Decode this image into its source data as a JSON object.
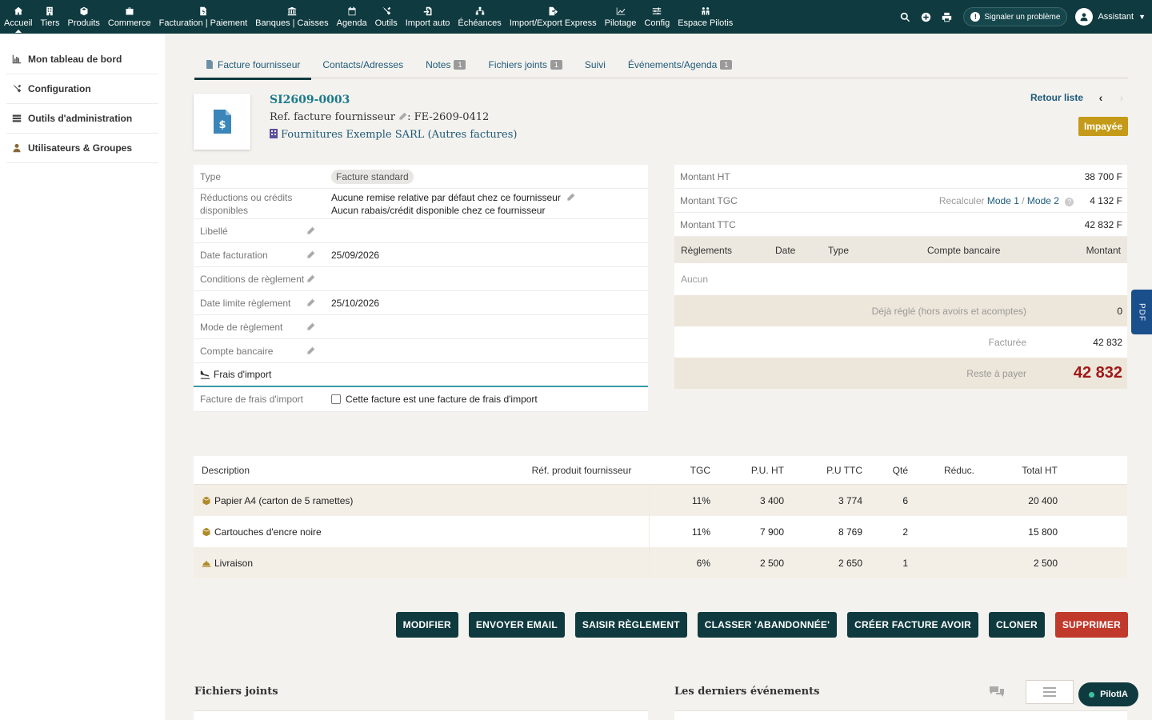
{
  "topbar": {
    "menu": [
      {
        "label": "Accueil",
        "icon": "home-icon"
      },
      {
        "label": "Tiers",
        "icon": "building-icon"
      },
      {
        "label": "Produits",
        "icon": "cube-icon"
      },
      {
        "label": "Commerce",
        "icon": "briefcase-icon"
      },
      {
        "label": "Facturation | Paiement",
        "icon": "file-dollar-icon"
      },
      {
        "label": "Banques | Caisses",
        "icon": "bank-icon"
      },
      {
        "label": "Agenda",
        "icon": "calendar-icon"
      },
      {
        "label": "Outils",
        "icon": "tools-icon"
      },
      {
        "label": "Import auto",
        "icon": "file-import-icon"
      },
      {
        "label": "Échéances",
        "icon": "sitemap-icon"
      },
      {
        "label": "Import/Export Express",
        "icon": "file-export-icon"
      },
      {
        "label": "Pilotage",
        "icon": "chart-icon"
      },
      {
        "label": "Config",
        "icon": "sliders-icon"
      },
      {
        "label": "Espace Pilotis",
        "icon": "people-icon"
      }
    ],
    "report_label": "Signaler un problème",
    "user_label": "Assistant"
  },
  "sidebar": {
    "items": [
      {
        "label": "Mon tableau de bord"
      },
      {
        "label": "Configuration"
      },
      {
        "label": "Outils d'administration"
      },
      {
        "label": "Utilisateurs & Groupes"
      }
    ]
  },
  "tabs": [
    {
      "label": "Facture fournisseur",
      "badge": ""
    },
    {
      "label": "Contacts/Adresses",
      "badge": ""
    },
    {
      "label": "Notes",
      "badge": "1"
    },
    {
      "label": "Fichiers joints",
      "badge": "1"
    },
    {
      "label": "Suivi",
      "badge": ""
    },
    {
      "label": "Événements/Agenda",
      "badge": "1"
    }
  ],
  "invoice": {
    "ref": "SI2609-0003",
    "supplier_ref_label": "Ref. facture fournisseur",
    "supplier_ref": ": FE-2609-0412",
    "supplier_name": "Fournitures Exemple SARL",
    "other_invoices": "(Autres factures)",
    "back_label": "Retour liste",
    "status": "Impayée"
  },
  "fields": {
    "type_label": "Type",
    "type_value": "Facture standard",
    "reductions_label": "Réductions ou crédits disponibles",
    "reductions_line1": "Aucune remise relative par défaut chez ce fournisseur",
    "reductions_line2": "Aucun rabais/crédit disponible chez ce fournisseur",
    "libelle_label": "Libellé",
    "libelle_value": "",
    "date_fact_label": "Date facturation",
    "date_fact_value": "25/09/2026",
    "conditions_label": "Conditions de règlement",
    "conditions_value": "",
    "date_limite_label": "Date limite règlement",
    "date_limite_value": "25/10/2026",
    "mode_label": "Mode de règlement",
    "mode_value": "",
    "compte_label": "Compte bancaire",
    "compte_value": "",
    "section_import": "Frais d'import",
    "import_label": "Facture de frais d'import",
    "import_checkbox": "Cette facture est une facture de frais d'import"
  },
  "totals": {
    "ht_label": "Montant HT",
    "ht_value": "38 700 F",
    "tgc_label": "Montant TGC",
    "recalc_label": "Recalculer",
    "mode1": "Mode 1",
    "sep": "/",
    "mode2": "Mode 2",
    "tgc_value": "4 132 F",
    "ttc_label": "Montant TTC",
    "ttc_value": "42 832 F",
    "pay_headers": [
      "Règlements",
      "Date",
      "Type",
      "Compte bancaire",
      "Montant"
    ],
    "pay_none": "Aucun",
    "deja_label": "Déjà réglé (hors avoirs et acomptes)",
    "deja_value": "0",
    "facturee_label": "Facturée",
    "facturee_value": "42 832",
    "reste_label": "Reste à payer",
    "reste_value": "42 832"
  },
  "lines": {
    "headers": {
      "desc": "Description",
      "ref": "Réf. produit fournisseur",
      "tgc": "TGC",
      "pu": "P.U. HT",
      "pttc": "P.U TTC",
      "qte": "Qté",
      "red": "Réduc.",
      "tot": "Total HT"
    },
    "rows": [
      {
        "desc": "Papier A4 (carton de 5 ramettes)",
        "icon": "product-icon",
        "ref": "",
        "tgc": "11%",
        "pu": "3 400",
        "pttc": "3 774",
        "qte": "6",
        "red": "",
        "tot": "20 400"
      },
      {
        "desc": "Cartouches d'encre noire",
        "icon": "product-icon",
        "ref": "",
        "tgc": "11%",
        "pu": "7 900",
        "pttc": "8 769",
        "qte": "2",
        "red": "",
        "tot": "15 800"
      },
      {
        "desc": "Livraison",
        "icon": "service-icon",
        "ref": "",
        "tgc": "6%",
        "pu": "2 500",
        "pttc": "2 650",
        "qte": "1",
        "red": "",
        "tot": "2 500"
      }
    ]
  },
  "actions": {
    "modifier": "MODIFIER",
    "email": "ENVOYER EMAIL",
    "reglement": "SAISIR RÈGLEMENT",
    "abandon": "CLASSER 'ABANDONNÉE'",
    "avoir": "CRÉER FACTURE AVOIR",
    "cloner": "CLONER",
    "supprimer": "SUPPRIMER"
  },
  "bottom": {
    "files_title": "Fichiers joints",
    "events_title": "Les derniers événements",
    "pilotia": "PilotIA",
    "pdf": "PDF"
  },
  "colors": {
    "topbar": "#0f3a3f",
    "status": "#c49a18",
    "danger": "#c0392b",
    "remaining": "#a01818"
  }
}
